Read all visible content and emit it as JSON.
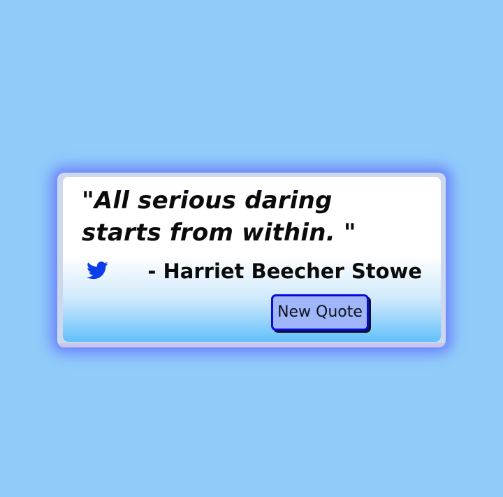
{
  "quote_box": {
    "quote_text": "\"All serious daring starts from within. \"",
    "author_text": "- Harriet Beecher Stowe",
    "tweet_icon": "twitter-bird-icon",
    "new_quote_label": "New Quote"
  },
  "colors": {
    "page_background": "#90cbfa",
    "glow": "#6f8cfb",
    "icon": "#0b3de9",
    "button_border": "#0a0ae0",
    "button_fill": "#9fb7f8"
  }
}
